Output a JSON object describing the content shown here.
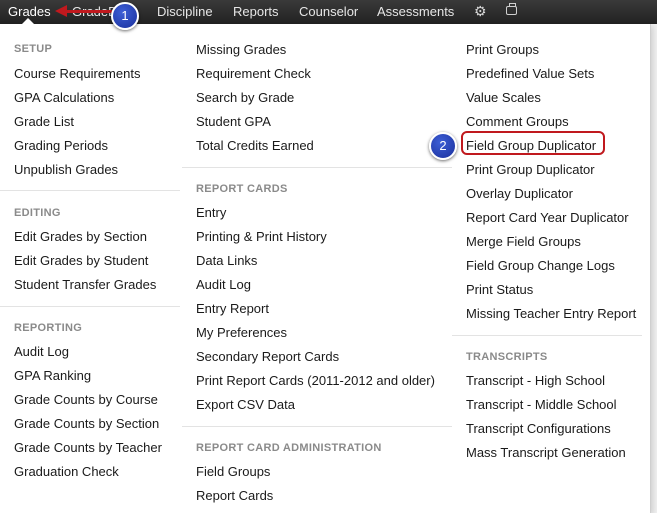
{
  "nav": {
    "items": [
      "Grades",
      "GradeB",
      "Discipline",
      "Reports",
      "Counselor",
      "Assessments"
    ],
    "gear_icon": "gear-icon",
    "printer_icon": "printer-icon"
  },
  "menu": {
    "col1": {
      "setup_header": "SETUP",
      "setup": [
        "Course Requirements",
        "GPA Calculations",
        "Grade List",
        "Grading Periods",
        "Unpublish Grades"
      ],
      "editing_header": "EDITING",
      "editing": [
        "Edit Grades by Section",
        "Edit Grades by Student",
        "Student Transfer Grades"
      ],
      "reporting_header": "REPORTING",
      "reporting": [
        "Audit Log",
        "GPA Ranking",
        "Grade Counts by Course",
        "Grade Counts by Section",
        "Grade Counts by Teacher",
        "Graduation Check"
      ]
    },
    "col2": {
      "top": [
        "Missing Grades",
        "Requirement Check",
        "Search by Grade",
        "Student GPA",
        "Total Credits Earned"
      ],
      "report_cards_header": "REPORT CARDS",
      "report_cards": [
        "Entry",
        "Printing & Print History",
        "Data Links",
        "Audit Log",
        "Entry Report",
        "My Preferences",
        "Secondary Report Cards",
        "Print Report Cards (2011-2012 and older)",
        "Export CSV Data"
      ],
      "rc_admin_header": "REPORT CARD ADMINISTRATION",
      "rc_admin": [
        "Field Groups",
        "Report Cards"
      ]
    },
    "col3": {
      "top": [
        "Print Groups",
        "Predefined Value Sets",
        "Value Scales",
        "Comment Groups",
        "Field Group Duplicator",
        "Print Group Duplicator",
        "Overlay Duplicator",
        "Report Card Year Duplicator",
        "Merge Field Groups",
        "Field Group Change Logs",
        "Print Status",
        "Missing Teacher Entry Report"
      ],
      "transcripts_header": "TRANSCRIPTS",
      "transcripts": [
        "Transcript - High School",
        "Transcript - Middle School",
        "Transcript Configurations",
        "Mass Transcript Generation"
      ]
    }
  },
  "callouts": [
    "1",
    "2"
  ],
  "colors": {
    "accent": "#c0191e",
    "badge": "#2a46bf",
    "nav_bg": "#2b2b2b"
  }
}
